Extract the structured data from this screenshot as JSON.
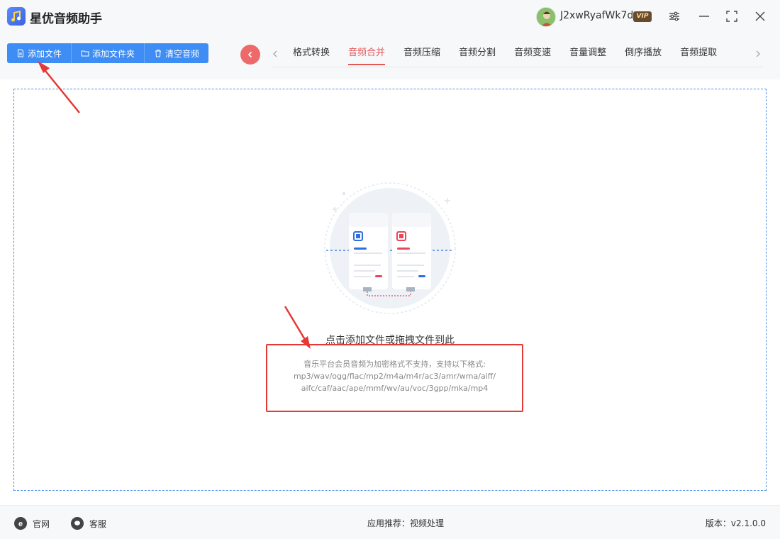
{
  "app": {
    "title": "星优音频助手",
    "logo_icon": "music-note-icon"
  },
  "user": {
    "name": "J2xwRyafWk7d",
    "vip": "VIP"
  },
  "toolbar": {
    "add_file": "添加文件",
    "add_folder": "添加文件夹",
    "clear_audio": "清空音频"
  },
  "tabs": [
    {
      "label": "格式转换",
      "active": false
    },
    {
      "label": "音频合并",
      "active": true
    },
    {
      "label": "音频压缩",
      "active": false
    },
    {
      "label": "音频分割",
      "active": false
    },
    {
      "label": "音频变速",
      "active": false
    },
    {
      "label": "音量调整",
      "active": false
    },
    {
      "label": "倒序播放",
      "active": false
    },
    {
      "label": "音频提取",
      "active": false
    }
  ],
  "drop": {
    "title": "点击添加文件或拖拽文件到此",
    "formats_line1": "音乐平台会员音频为加密格式不支持，支持以下格式:",
    "formats_line2": "mp3/wav/ogg/flac/mp2/m4a/m4r/ac3/amr/wma/aiff/",
    "formats_line3": "aifc/caf/aac/ape/mmf/wv/au/voc/3gpp/mka/mp4"
  },
  "footer": {
    "website": "官网",
    "service": "客服",
    "recommend_label": "应用推荐：",
    "recommend_app": "视频处理",
    "version": "版本：v2.1.0.0"
  },
  "colors": {
    "accent": "#3e8df4",
    "active_tab": "#e05a5a",
    "highlight": "#e53935"
  }
}
